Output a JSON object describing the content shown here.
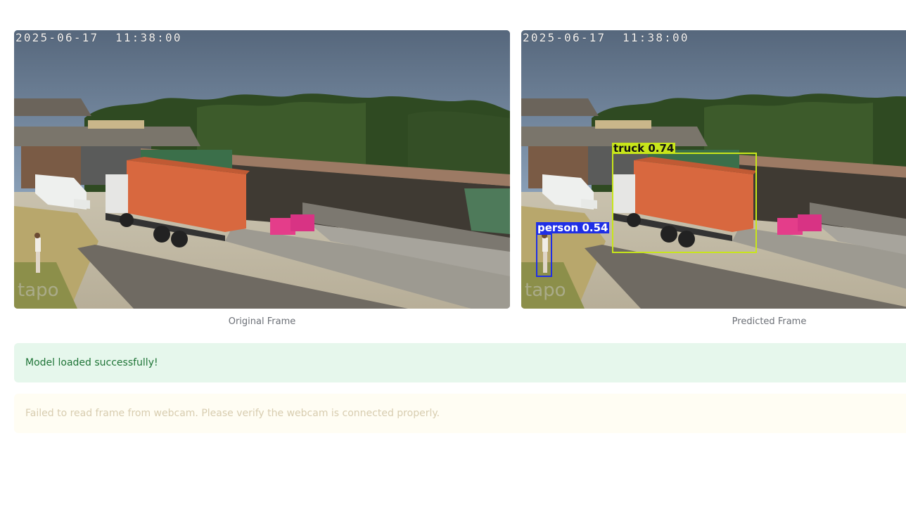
{
  "frames": {
    "original": {
      "timestamp": "2025-06-17  11:38:00",
      "caption": "Original Frame"
    },
    "predicted": {
      "timestamp": "2025-06-17  11:38:00",
      "caption": "Predicted Frame",
      "detections": [
        {
          "label": "truck 0.74",
          "color": "#c8e61a",
          "text_color": "#111111"
        },
        {
          "label": "person 0.54",
          "color": "#1f2fe6",
          "text_color": "#ffffff"
        }
      ]
    }
  },
  "alerts": {
    "success": "Model loaded successfully!",
    "warning": "Failed to read frame from webcam. Please verify the webcam is connected properly."
  }
}
